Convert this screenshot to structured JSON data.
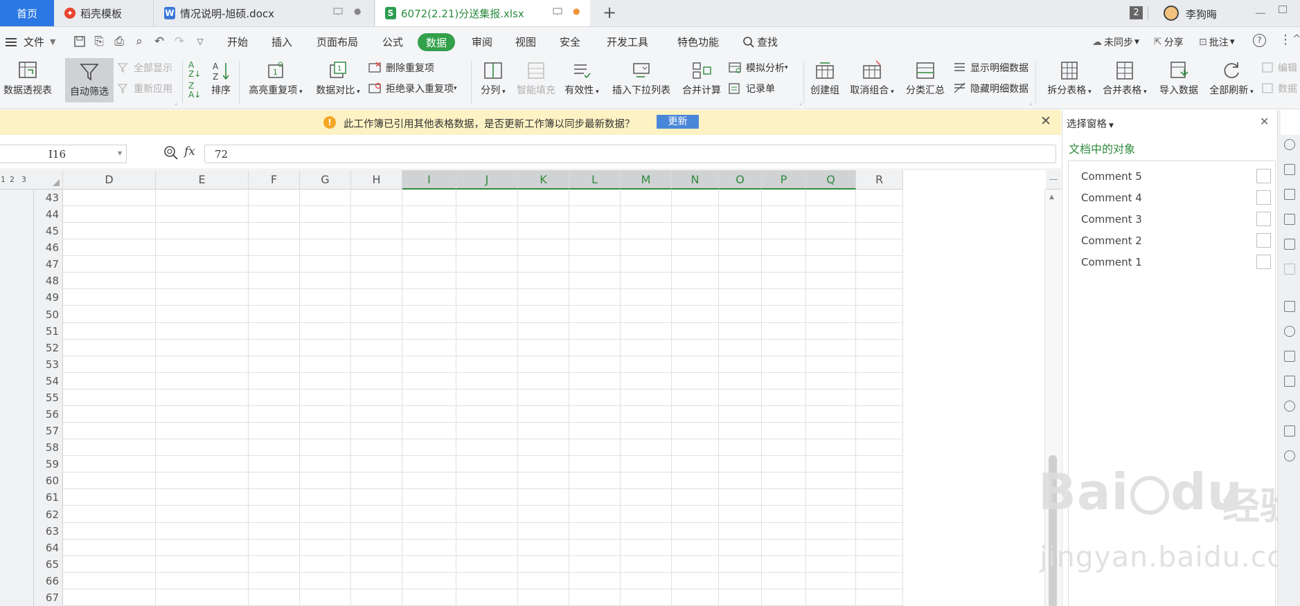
{
  "tabs": [
    {
      "label": "首页",
      "kind": "home"
    },
    {
      "label": "稻壳模板",
      "kind": "daoke"
    },
    {
      "label": "情况说明-旭硕.docx",
      "kind": "word"
    },
    {
      "label": "6072(2.21)分送集报.xlsx",
      "kind": "sheet"
    }
  ],
  "titlebar": {
    "window_count": "2",
    "user_name": "李狗晦",
    "new_tab": "+"
  },
  "menu": {
    "file_label": "文件",
    "items": [
      "开始",
      "插入",
      "页面布局",
      "公式",
      "数据",
      "审阅",
      "视图",
      "安全",
      "开发工具",
      "特色功能"
    ],
    "active": "数据",
    "search_label": "查找",
    "right": {
      "sync": "未同步",
      "share": "分享",
      "comment": "批注"
    }
  },
  "ribbon": {
    "pivot": "数据透视表",
    "autofilter": "自动筛选",
    "show_all": "全部显示",
    "reapply": "重新应用",
    "sort": "排序",
    "highlight_dup": "高亮重复项",
    "data_compare": "数据对比",
    "delete_dup": "删除重复项",
    "reject_dup": "拒绝录入重复项",
    "split_col": "分列",
    "smart_fill": "智能填充",
    "validity": "有效性",
    "insert_dropdown": "插入下拉列表",
    "merge_calc": "合并计算",
    "what_if": "模拟分析",
    "record_form": "记录单",
    "create_group": "创建组",
    "ungroup": "取消组合",
    "subtotal": "分类汇总",
    "show_detail": "显示明细数据",
    "hide_detail": "隐藏明细数据",
    "split_table": "拆分表格",
    "merge_table": "合并表格",
    "import_data": "导入数据",
    "refresh_all": "全部刷新",
    "edit": "编辑",
    "data": "数据"
  },
  "notice": {
    "message": "此工作簿已引用其他表格数据，是否更新工作簿以同步最新数据？",
    "button": "更新"
  },
  "formula_bar": {
    "cell_ref": "I16",
    "fx": "fx",
    "value": "72"
  },
  "grid": {
    "outline_levels": [
      "1",
      "2",
      "3"
    ],
    "columns": [
      "D",
      "E",
      "F",
      "G",
      "H",
      "I",
      "J",
      "K",
      "L",
      "M",
      "N",
      "O",
      "P",
      "Q",
      "R"
    ],
    "selected_columns": [
      "I",
      "J",
      "K",
      "L",
      "M",
      "N",
      "O",
      "P",
      "Q"
    ],
    "rows": [
      "43",
      "44",
      "45",
      "46",
      "47",
      "48",
      "49",
      "50",
      "51",
      "52",
      "53",
      "54",
      "55",
      "56",
      "57",
      "58",
      "59",
      "60",
      "61",
      "62",
      "63",
      "64",
      "65",
      "66",
      "67"
    ]
  },
  "panel": {
    "title": "选择窗格",
    "section": "文档中的对象",
    "objects": [
      "Comment 5",
      "Comment 4",
      "Comment 3",
      "Comment 2",
      "Comment 1"
    ]
  },
  "watermark": {
    "logo": "Bai",
    "logo2": "du",
    "cn": "经验",
    "url": "jingyan.baidu.com"
  },
  "colors": {
    "accent_green": "#33a04a",
    "home_tab_blue": "#2b78e4",
    "notice_bg": "#fdf2c3",
    "update_btn": "#4a86d8"
  }
}
